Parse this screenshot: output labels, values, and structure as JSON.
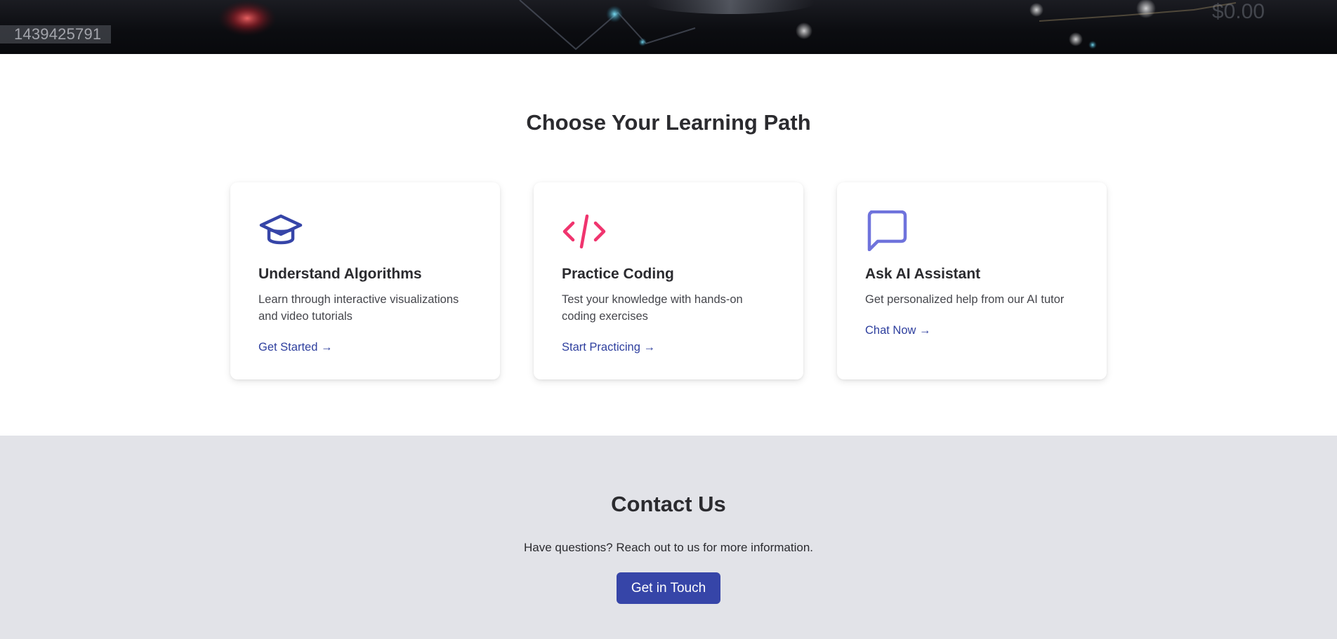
{
  "hero": {
    "image_id_overlay": "1439425791",
    "background_text": "$0.00"
  },
  "paths": {
    "title": "Choose Your Learning Path",
    "cards": [
      {
        "icon": "graduation-cap-icon",
        "icon_color": "#3645a8",
        "title": "Understand Algorithms",
        "description": "Learn through interactive visualizations and video tutorials",
        "link": "Get Started →"
      },
      {
        "icon": "code-icon",
        "icon_color": "#f0346e",
        "title": "Practice Coding",
        "description": "Test your knowledge with hands-on coding exercises",
        "link": "Start Practicing →"
      },
      {
        "icon": "chat-bubble-icon",
        "icon_color": "#6f73dc",
        "title": "Ask AI Assistant",
        "description": "Get personalized help from our AI tutor",
        "link": "Chat Now →"
      }
    ]
  },
  "contact": {
    "title": "Contact Us",
    "text": "Have questions? Reach out to us for more information.",
    "button": "Get in Touch"
  },
  "colors": {
    "primary": "#3645a8",
    "accent_pink": "#f0346e",
    "accent_violet": "#6f73dc",
    "contact_bg": "#e2e3e8"
  }
}
